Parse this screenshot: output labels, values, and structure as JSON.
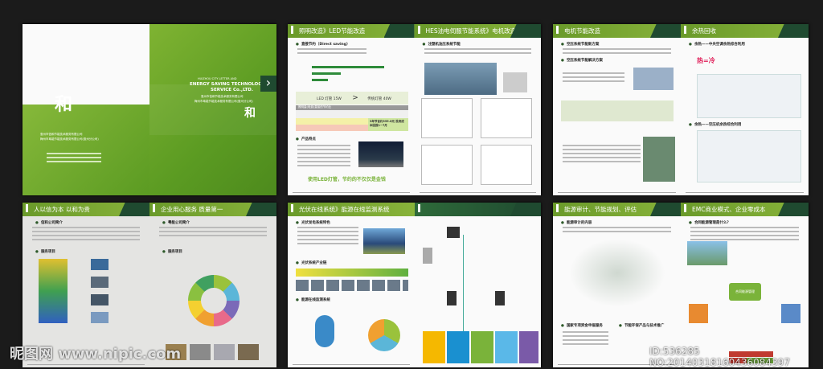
{
  "cover": {
    "top_small": "HUIZHOU CITY LETTER AND",
    "company_en_1": "ENERGY SAVING TECHNOLOGY",
    "company_en_2": "SERVICE Co.,LTD.",
    "company_cn_1": "惠州市信和节能技术服务有限公司",
    "company_cn_2": "梅州市粤能节能技术服务有限公司(惠州分公司)",
    "logo": "和",
    "arrow": "›"
  },
  "spreads": [
    {
      "left_title": "照明改造》LED节能改造",
      "right_title": "HES油电伺服节能系统》电机改造",
      "sections": [
        "直接节约（Direct saving）",
        "产品特点",
        "注塑机油压系统节能"
      ],
      "led_label": "LED 灯管 15W",
      "vs": ">",
      "trad_label": "传统灯管 40W",
      "table_title": "照明量(电费)直接的节约比",
      "slogan": "使用LED灯管，节约的不仅仅是金钱",
      "saving_note": "3年节省约355.8元 投资成本回报1~7月"
    },
    {
      "left_title": "电机节能改造",
      "right_title": "余热回收",
      "sections": [
        "空压系统节能新方案",
        "空压系统节能解决方案",
        "余热——中央空调余热综合利用",
        "余热——空压机余热综合利用"
      ],
      "heat_label": "热=冷"
    },
    {
      "left_title": "人以信为本 以和为贵",
      "right_title": "企业用心服务 质量第一",
      "sections": [
        "信和公司简介",
        "服务项目",
        "粤能公司简介",
        "服务项目"
      ]
    },
    {
      "left_title": "光伏在线系统》能源在线监测系统",
      "right_title": "",
      "sections": [
        "光伏发电系统特色",
        "光伏系统产业链",
        "能源在线监测系统"
      ]
    },
    {
      "left_title": "能源审计、节能规划、评估",
      "right_title": "EMC商业模式、企业零成本",
      "sections": [
        "能源审计的内容",
        "国家专项资金申报服务",
        "节能环保产品与技术推广",
        "合同能源管理是什么？"
      ],
      "diagram_center": "合同能源管理"
    }
  ],
  "watermark": {
    "site": "昵图网 www.nipic.com",
    "id": "ID:536285 NO:20140318160436084397"
  },
  "colors": {
    "green": "#7aab2e",
    "dark_green": "#1f4a30",
    "background": "#1b1b1b"
  }
}
